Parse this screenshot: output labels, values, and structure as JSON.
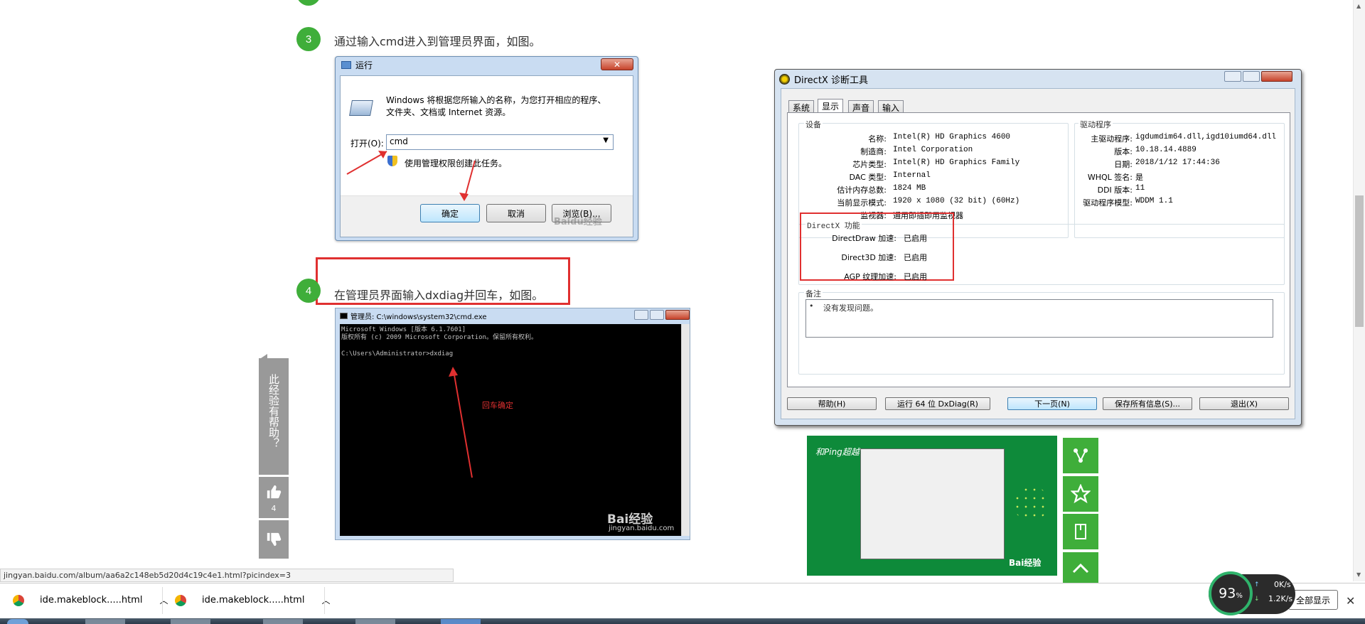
{
  "steps": {
    "step3": {
      "num": "3",
      "text": "通过输入cmd进入到管理员界面，如图。"
    },
    "step4": {
      "num": "4",
      "text": "在管理员界面输入dxdiag并回车，如图。"
    }
  },
  "run_dialog": {
    "title": "运行",
    "close": "✕",
    "description": "Windows 将根据您所输入的名称，为您打开相应的程序、文件夹、文档或 Internet 资源。",
    "open_label": "打开(O):",
    "open_value": "cmd",
    "admin_note": "使用管理权限创建此任务。",
    "ok": "确定",
    "cancel": "取消",
    "browse": "浏览(B)...",
    "watermark": "Baidu经验"
  },
  "cmd_window": {
    "title": "管理员: C:\\windows\\system32\\cmd.exe",
    "line1": "Microsoft Windows [版本 6.1.7601]",
    "line2": "版权所有 (c) 2009 Microsoft Corporation。保留所有权利。",
    "line3": "C:\\Users\\Administrator>dxdiag",
    "annotation": "回车确定",
    "watermark_brand": "Bai经验",
    "watermark_url": "jingyan.baidu.com"
  },
  "dx": {
    "title": "DirectX 诊断工具",
    "tabs": [
      "系统",
      "显示",
      "声音",
      "输入"
    ],
    "device_group": "设备",
    "device": [
      {
        "label": "名称:",
        "value": "Intel(R) HD Graphics 4600"
      },
      {
        "label": "制造商:",
        "value": "Intel Corporation"
      },
      {
        "label": "芯片类型:",
        "value": "Intel(R) HD Graphics Family"
      },
      {
        "label": "DAC 类型:",
        "value": "Internal"
      },
      {
        "label": "估计内存总数:",
        "value": "1824 MB"
      },
      {
        "label": "当前显示模式:",
        "value": "1920 x 1080 (32 bit) (60Hz)"
      },
      {
        "label": "监视器:",
        "value": "通用即插即用监视器"
      }
    ],
    "driver_group": "驱动程序",
    "driver": [
      {
        "label": "主驱动程序:",
        "value": "igdumdim64.dll,igd10iumd64.dll"
      },
      {
        "label": "版本:",
        "value": "10.18.14.4889"
      },
      {
        "label": "日期:",
        "value": "2018/1/12 17:44:36"
      },
      {
        "label": "WHQL 签名:",
        "value": "是"
      },
      {
        "label": "DDI 版本:",
        "value": "11"
      },
      {
        "label": "驱动程序模型:",
        "value": "WDDM 1.1"
      }
    ],
    "features_group": "DirectX 功能",
    "features": [
      {
        "label": "DirectDraw 加速:",
        "value": "已启用"
      },
      {
        "label": "Direct3D 加速:",
        "value": "已启用"
      },
      {
        "label": "AGP 纹理加速:",
        "value": "已启用"
      }
    ],
    "notes_group": "备注",
    "notes_item": "没有发现问题。",
    "buttons": {
      "help": "帮助(H)",
      "run64": "运行 64 位 DxDiag(R)",
      "next": "下一页(N)",
      "save": "保存所有信息(S)...",
      "exit": "退出(X)"
    }
  },
  "thumbnail": {
    "brand": "Bai经验",
    "top_text": "和Ping超越"
  },
  "side_panel": {
    "question": "此经验有帮助？",
    "like_count": "4"
  },
  "status_url": "jingyan.baidu.com/album/aa6a2c148eb5d20d4c19c4e1.html?picindex=3",
  "downloads": {
    "item1": "ide.makeblock.....html",
    "item2": "ide.makeblock.....html",
    "show_all": "全部显示"
  },
  "speed": {
    "percent": "93",
    "percent_unit": "%",
    "up": "0K/s",
    "down": "1.2K/s"
  },
  "colors": {
    "accent_green": "#3fae3a",
    "annotation_red": "#e03030"
  }
}
